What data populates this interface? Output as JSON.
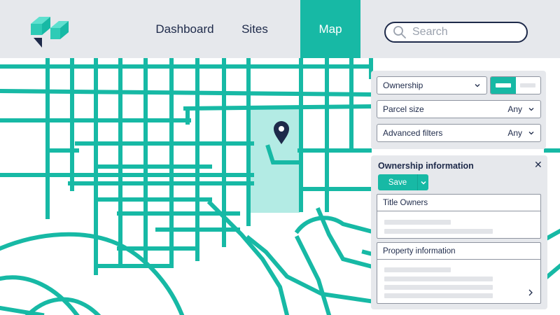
{
  "header": {
    "nav": [
      {
        "label": "Dashboard",
        "active": false
      },
      {
        "label": "Sites",
        "active": false
      },
      {
        "label": "Map",
        "active": true
      }
    ],
    "search": {
      "placeholder": "Search",
      "icon": "search-icon"
    }
  },
  "colors": {
    "accent": "#17b9a5",
    "selected_parcel": "#b3ebe4",
    "header_bg": "#e6e8ec",
    "text": "#1e2a4a",
    "marker": "#1e2a4a"
  },
  "filters": {
    "ownership": {
      "label": "Ownership",
      "icon": "chevron-down-icon"
    },
    "view_toggle": {
      "selected": "first"
    },
    "parcel_size": {
      "label": "Parcel size",
      "value": "Any",
      "icon": "chevron-down-icon"
    },
    "advanced": {
      "label": "Advanced filters",
      "value": "Any",
      "icon": "chevron-down-icon"
    }
  },
  "info_panel": {
    "title": "Ownership information",
    "close_icon": "close-icon",
    "save_label": "Save",
    "sections": [
      {
        "title": "Title Owners"
      },
      {
        "title": "Property information"
      }
    ]
  },
  "map": {
    "marker_icon": "location-pin-icon"
  }
}
